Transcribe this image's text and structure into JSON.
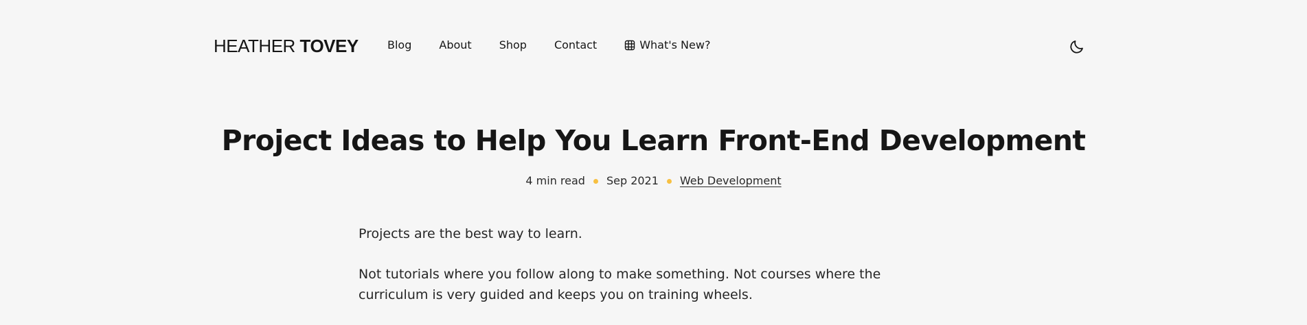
{
  "header": {
    "logo": {
      "first": "HEATHER",
      "last": "TOVEY"
    },
    "nav": [
      {
        "label": "Blog",
        "icon": null
      },
      {
        "label": "About",
        "icon": null
      },
      {
        "label": "Shop",
        "icon": null
      },
      {
        "label": "Contact",
        "icon": null
      },
      {
        "label": "What's New?",
        "icon": "grid-table-icon"
      }
    ],
    "theme_toggle_icon": "moon-icon"
  },
  "post": {
    "title": "Project Ideas to Help You Learn Front-End Development",
    "meta": {
      "read_time": "4 min read",
      "date": "Sep 2021",
      "category": "Web Development"
    },
    "paragraphs": [
      "Projects are the best way to learn.",
      "Not tutorials where you follow along to make something. Not courses where the curriculum is very guided and keeps you on training wheels."
    ]
  },
  "colors": {
    "background": "#f6f6f6",
    "text": "#161616",
    "accent_dot": "#f7c042"
  }
}
